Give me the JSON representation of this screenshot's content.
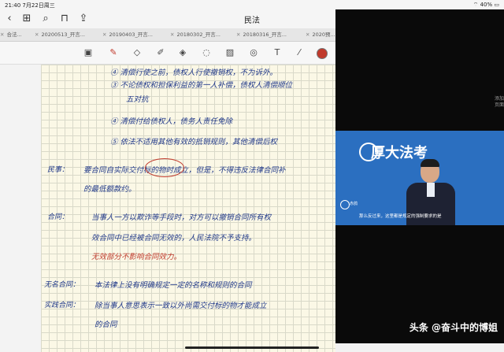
{
  "statusbar": {
    "time": "21:40",
    "date": "7月22日周三",
    "battery": "40%"
  },
  "navbar": {
    "title": "民法"
  },
  "tabs": [
    "合法...",
    "20200513_开言...",
    "20190403_开言...",
    "20180302_开言...",
    "20180316_开言...",
    "2020预..."
  ],
  "notes": {
    "line1": "④ 清偿行使之前，债权人行使撤销权，不为诉外。",
    "line2": "③ 不论债权和担保利益的第一人补偿，债权人清偿顺位",
    "line3": "五对抗",
    "line4": "④ 清偿付给债权人，债务人责任免除",
    "line5": "⑤ 依法不适用其他有效的抵销规则，其他清偿后权",
    "term1": "民事：",
    "line6": "要合同自实际交付标的物时成立，但是，不得违反法律合同补",
    "line7": "的最低额款约。",
    "term2": "合同：",
    "line8": "当事人一方以欺诈等手段时，对方可以撤销合同所有权",
    "line9": "效合同中已经被合同无效的，人民法院不予支持。",
    "red_note": "无效部分不影响合同效力。",
    "term3": "无名合同：",
    "line10": "本法律上没有明确规定一定的名称和规则的合同",
    "term4": "实践合同：",
    "line11": "除当事人意思表示一致以外尚需交付标的物才能成立",
    "line12": "的合同"
  },
  "video": {
    "brand": "厚大法考",
    "subtitle": "那么反过来，这里都是规定的强制要求的是",
    "corner_label": "赤鸽",
    "watermark": "头条 @奋斗中的博姐"
  },
  "side_hint": "添加页面"
}
